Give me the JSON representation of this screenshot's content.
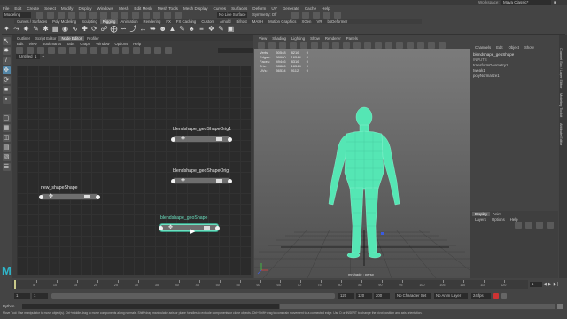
{
  "titlebar": {
    "workspace_label": "Workspace:",
    "workspace_value": "Maya Classic*"
  },
  "menubar": {
    "items": [
      "File",
      "Edit",
      "Create",
      "Select",
      "Modify",
      "Display",
      "Windows",
      "Mesh",
      "Edit Mesh",
      "Mesh Tools",
      "Mesh Display",
      "Curves",
      "Surfaces",
      "Deform",
      "UV",
      "Generate",
      "Cache",
      "Help"
    ]
  },
  "statusline": {
    "mode": "Modeling",
    "no_live_surface": "No Live Surface",
    "symmetry": "Symmetry: Off"
  },
  "shelf": {
    "tabs": [
      "Curves / Surfaces",
      "Poly Modeling",
      "Sculpting",
      "Rigging",
      "Animation",
      "Rendering",
      "FX",
      "FX Caching",
      "Custom",
      "Arnold",
      "Bifrost",
      "MASH",
      "Motion Graphics",
      "XGen",
      "VR",
      "bpDeformer"
    ],
    "active_tab": "Rigging",
    "icons": [
      "joint-icon",
      "ik-handle-icon",
      "bind-skin-icon",
      "paint-weights-icon",
      "cluster-icon",
      "lattice-icon",
      "blendshape-icon",
      "wire-icon",
      "constraint-point-icon",
      "constraint-orient-icon",
      "constraint-parent-icon",
      "locator-icon",
      "curve-icon",
      "spline-ik-icon",
      "mirror-joint-icon",
      "orient-joint-icon",
      "hik-icon",
      "skin-icon",
      "brush-icon",
      "pose-icon",
      "align-icon",
      "snap-icon",
      "sculpt-icon",
      "wrap-icon"
    ]
  },
  "node_editor": {
    "tabs": [
      "Outliner",
      "Script Editor",
      "Node Editor",
      "Profiler"
    ],
    "active_tab": "Node Editor",
    "menu": [
      "Edit",
      "View",
      "Bookmarks",
      "Tabs",
      "Graph",
      "Window",
      "Options",
      "Help"
    ],
    "graph_tab": "Untitled_1",
    "nodes": [
      {
        "name": "blendshape_geoShapeOrig1",
        "selected": false
      },
      {
        "name": "blendshape_geoShapeOrig",
        "selected": false
      },
      {
        "name": "new_shapeShape",
        "selected": false
      },
      {
        "name": "blendshape_geoShape",
        "selected": true
      }
    ]
  },
  "viewport": {
    "menu": [
      "View",
      "Shading",
      "Lighting",
      "Show",
      "Renderer",
      "Panels"
    ],
    "hud": {
      "rows": [
        {
          "label": "Verts:",
          "a": "50548",
          "b": "8216",
          "c": "0"
        },
        {
          "label": "Edges:",
          "a": "99990",
          "b": "16544",
          "c": "0"
        },
        {
          "label": "Faces:",
          "a": "49446",
          "b": "8316",
          "c": "0"
        },
        {
          "label": "Tris:",
          "a": "98886",
          "b": "16544",
          "c": "0"
        },
        {
          "label": "UVs:",
          "a": "56534",
          "b": "9112",
          "c": "0"
        }
      ]
    },
    "camera_label": "mrshade : persp",
    "mesh_color": "#55e6b4"
  },
  "channel_box": {
    "menu": [
      "Channels",
      "Edit",
      "Object",
      "Show"
    ],
    "object": "blendshape_geoShape",
    "sections": [
      "INPUTS",
      "transformGeometry1",
      "tweak1",
      "polyNormalize1"
    ],
    "layer_tabs": [
      "Display",
      "Anim"
    ],
    "layer_menu": [
      "Layers",
      "Options",
      "Help"
    ],
    "side_labels": [
      "Channel Box / Layer Editor",
      "Modeling Toolkit",
      "Attribute Editor"
    ]
  },
  "timeline": {
    "ticks": [
      "5",
      "10",
      "15",
      "20",
      "25",
      "30",
      "35",
      "40",
      "45",
      "50",
      "55",
      "60",
      "65",
      "70",
      "75",
      "80",
      "85",
      "90",
      "95",
      "100",
      "105",
      "110",
      "115",
      "120"
    ],
    "current_frame": "1"
  },
  "range": {
    "start": "1",
    "inner_start": "1",
    "inner_end": "120",
    "end": "120",
    "end2": "200",
    "character_set": "No Character Set",
    "anim_layer": "No Anim Layer",
    "fps": "24 fps"
  },
  "commandline": {
    "lang": "Python"
  },
  "helpline": {
    "text": "Move Tool: Use manipulator to move object(s). Ctrl+middle-drag to move components along normals. Shift+drag manipulator axis or plane handles to extrude components or clone objects. Ctrl+Shift+drag to constrain movement to a connected edge. Use D or INSERT to change the pivot position and axis orientation."
  }
}
